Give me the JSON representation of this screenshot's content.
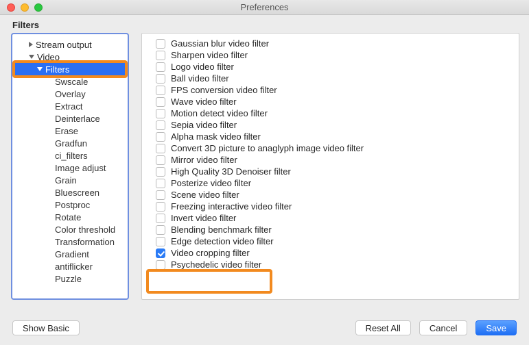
{
  "window": {
    "title": "Preferences"
  },
  "section": {
    "title": "Filters"
  },
  "sidebar": {
    "items": [
      {
        "label": "Stream output",
        "arrow": "right",
        "level": "top"
      },
      {
        "label": "Video",
        "arrow": "down",
        "level": "top"
      },
      {
        "label": "Filters",
        "arrow": "down",
        "level": "lv1",
        "selected": true
      },
      {
        "label": "Swscale",
        "level": "child"
      },
      {
        "label": "Overlay",
        "level": "child"
      },
      {
        "label": "Extract",
        "level": "child"
      },
      {
        "label": "Deinterlace",
        "level": "child"
      },
      {
        "label": "Erase",
        "level": "child"
      },
      {
        "label": "Gradfun",
        "level": "child"
      },
      {
        "label": "ci_filters",
        "level": "child"
      },
      {
        "label": "Image adjust",
        "level": "child"
      },
      {
        "label": "Grain",
        "level": "child"
      },
      {
        "label": "Bluescreen",
        "level": "child"
      },
      {
        "label": "Postproc",
        "level": "child"
      },
      {
        "label": "Rotate",
        "level": "child"
      },
      {
        "label": "Color threshold",
        "level": "child"
      },
      {
        "label": "Transformation",
        "level": "child"
      },
      {
        "label": "Gradient",
        "level": "child"
      },
      {
        "label": "antiflicker",
        "level": "child"
      },
      {
        "label": "Puzzle",
        "level": "child"
      }
    ]
  },
  "filters": [
    {
      "label": "Gaussian blur video filter",
      "checked": false
    },
    {
      "label": "Sharpen video filter",
      "checked": false
    },
    {
      "label": "Logo video filter",
      "checked": false
    },
    {
      "label": "Ball video filter",
      "checked": false
    },
    {
      "label": "FPS conversion video filter",
      "checked": false
    },
    {
      "label": "Wave video filter",
      "checked": false
    },
    {
      "label": "Motion detect video filter",
      "checked": false
    },
    {
      "label": "Sepia video filter",
      "checked": false
    },
    {
      "label": "Alpha mask video filter",
      "checked": false
    },
    {
      "label": "Convert 3D picture to anaglyph image video filter",
      "checked": false
    },
    {
      "label": "Mirror video filter",
      "checked": false
    },
    {
      "label": "High Quality 3D Denoiser filter",
      "checked": false
    },
    {
      "label": "Posterize video filter",
      "checked": false
    },
    {
      "label": "Scene video filter",
      "checked": false
    },
    {
      "label": "Freezing interactive video filter",
      "checked": false
    },
    {
      "label": "Invert video filter",
      "checked": false
    },
    {
      "label": "Blending benchmark filter",
      "checked": false
    },
    {
      "label": "Edge detection video filter",
      "checked": false
    },
    {
      "label": "Video cropping filter",
      "checked": true
    },
    {
      "label": "Psychedelic video filter",
      "checked": false
    }
  ],
  "buttons": {
    "show_basic": "Show Basic",
    "reset_all": "Reset All",
    "cancel": "Cancel",
    "save": "Save"
  }
}
